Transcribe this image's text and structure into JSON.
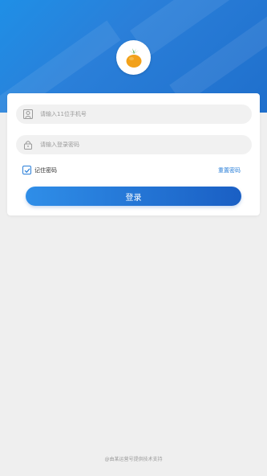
{
  "login": {
    "phone_placeholder": "请输入11位手机号",
    "password_placeholder": "请输入登录密码",
    "remember_label": "记住密码",
    "forgot_label": "重置密码",
    "submit_label": "登录",
    "remember_checked": true
  },
  "footer": {
    "text": "@由某运营号提供技术支持"
  },
  "icons": {
    "logo": "orange-fruit-logo",
    "phone_field": "user-icon",
    "password_field": "lock-icon",
    "checkbox": "check-icon"
  },
  "colors": {
    "primary": "#2a7fd9",
    "hero_start": "#1f8fe6",
    "hero_end": "#1f6fcc",
    "button_start": "#2f8ee8",
    "button_end": "#1a5fc4",
    "logo_orange": "#f2a11a",
    "leaf_green": "#3a9d3a"
  }
}
